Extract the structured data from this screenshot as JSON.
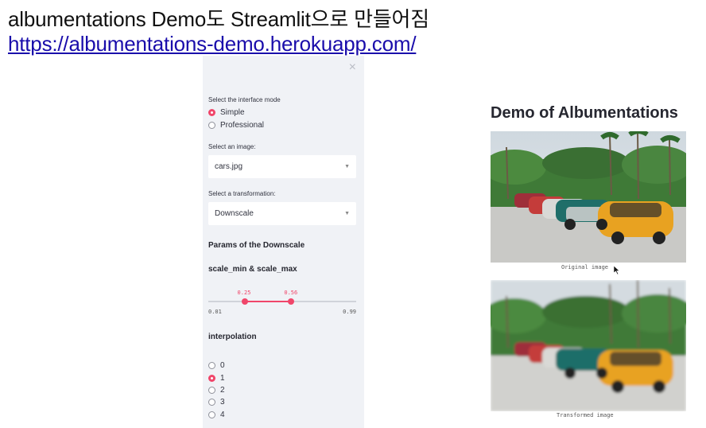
{
  "slide": {
    "title": "albumentations Demo도 Streamlit으로 만들어짐",
    "link": "https://albumentations-demo.herokuapp.com/"
  },
  "sidebar": {
    "close_glyph": "×",
    "interface_mode": {
      "label": "Select the interface mode",
      "options": [
        "Simple",
        "Professional"
      ],
      "selected": "Simple"
    },
    "image_select": {
      "label": "Select an image:",
      "value": "cars.jpg"
    },
    "transform_select": {
      "label": "Select a transformation:",
      "value": "Downscale"
    },
    "params_heading": "Params of the Downscale",
    "slider": {
      "label": "scale_min & scale_max",
      "min": "0.01",
      "max": "0.99",
      "low": "0.25",
      "high": "0.56",
      "low_value": 0.25,
      "high_value": 0.56,
      "min_value": 0.01,
      "max_value": 0.99
    },
    "interpolation": {
      "label": "interpolation",
      "options": [
        "0",
        "1",
        "2",
        "3",
        "4"
      ],
      "selected": "1"
    }
  },
  "main": {
    "title": "Demo of Albumentations",
    "original_caption": "Original image",
    "transformed_caption": "Transformed image"
  },
  "colors": {
    "accent": "#f0466a",
    "sidebar_bg": "#f0f2f6",
    "link": "#1a0dab"
  }
}
